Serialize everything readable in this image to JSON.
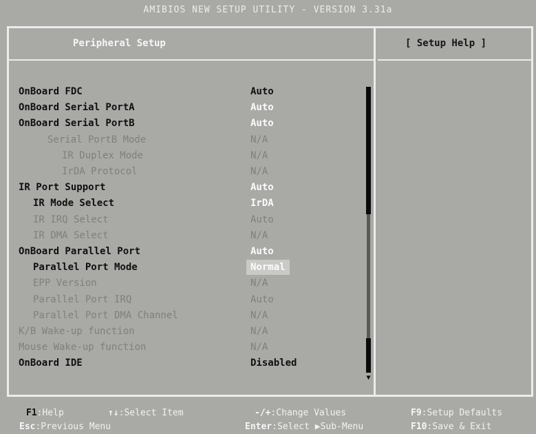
{
  "window": {
    "title": "AMIBIOS NEW SETUP UTILITY - VERSION 3.31a"
  },
  "header": {
    "left_title": "Peripheral Setup",
    "help_title": "[ Setup Help ]"
  },
  "settings": [
    {
      "label": "OnBoard FDC",
      "value": "Auto",
      "state": "active",
      "value_style": "black"
    },
    {
      "label": "OnBoard Serial PortA",
      "value": "Auto",
      "state": "active",
      "value_style": "white"
    },
    {
      "label": "OnBoard Serial PortB",
      "value": "Auto",
      "state": "active",
      "value_style": "white"
    },
    {
      "label": "Serial PortB Mode",
      "value": "N/A",
      "state": "disabled",
      "value_style": "dim"
    },
    {
      "label": "IR Duplex Mode",
      "value": "N/A",
      "state": "disabled",
      "value_style": "dim"
    },
    {
      "label": "IrDA Protocol",
      "value": "N/A",
      "state": "disabled",
      "value_style": "dim"
    },
    {
      "label": "IR Port Support",
      "value": "Auto",
      "state": "active",
      "value_style": "white"
    },
    {
      "label": "IR Mode Select",
      "value": "IrDA",
      "state": "active",
      "value_style": "white"
    },
    {
      "label": "IR IRQ Select",
      "value": "Auto",
      "state": "disabled",
      "value_style": "dim"
    },
    {
      "label": "IR DMA Select",
      "value": "N/A",
      "state": "disabled",
      "value_style": "dim"
    },
    {
      "label": "OnBoard Parallel Port",
      "value": "Auto",
      "state": "active",
      "value_style": "white"
    },
    {
      "label": "Parallel Port Mode",
      "value": "Normal",
      "state": "active",
      "value_style": "hilite"
    },
    {
      "label": "EPP Version",
      "value": "N/A",
      "state": "disabled",
      "value_style": "dim"
    },
    {
      "label": "Parallel Port IRQ",
      "value": "Auto",
      "state": "disabled",
      "value_style": "dim"
    },
    {
      "label": "Parallel Port DMA Channel",
      "value": "N/A",
      "state": "disabled",
      "value_style": "dim"
    },
    {
      "label": "K/B Wake-up function",
      "value": "N/A",
      "state": "disabled",
      "value_style": "dim"
    },
    {
      "label": "Mouse Wake-up function",
      "value": "N/A",
      "state": "disabled",
      "value_style": "dim"
    },
    {
      "label": "OnBoard IDE",
      "value": "Disabled",
      "state": "active",
      "value_style": "black"
    }
  ],
  "scrollbar": {
    "arrow": "▼"
  },
  "footer": {
    "help": {
      "key": "F1",
      "text": ":Help"
    },
    "select": {
      "key": "↑↓",
      "text": ":Select Item"
    },
    "change": {
      "key": "-/+",
      "text": ":Change Values"
    },
    "defaults": {
      "key": "F9",
      "text": ":Setup Defaults"
    },
    "prev": {
      "key": "Esc",
      "text": ":Previous Menu"
    },
    "enter": {
      "key": "Enter",
      "text": ":Select ▶Sub-Menu"
    },
    "save": {
      "key": "F10",
      "text": ":Save & Exit"
    }
  },
  "colors": {
    "background": "#a9a9a6",
    "frame": "#ececec",
    "text_active": "#101010",
    "text_disabled": "#7f7f7c"
  }
}
